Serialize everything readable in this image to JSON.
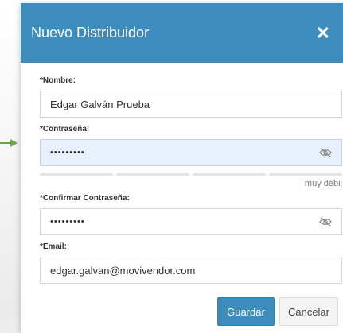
{
  "modal": {
    "title": "Nuevo Distribuidor",
    "close_icon": "close-icon"
  },
  "form": {
    "nombre": {
      "label": "*Nombre:",
      "value": "Edgar Galván Prueba"
    },
    "contrasena": {
      "label": "*Contraseña:",
      "value": "•••••••••",
      "icon": "eye-slash-icon"
    },
    "strength": {
      "text": "muy débil",
      "segments": 4,
      "filled": 0
    },
    "confirmar": {
      "label": "*Confirmar Contraseña:",
      "value": "•••••••••",
      "icon": "eye-slash-icon"
    },
    "email": {
      "label": "*Email:",
      "value": "edgar.galvan@movivendor.com"
    }
  },
  "buttons": {
    "guardar": "Guardar",
    "cancelar": "Cancelar"
  },
  "colors": {
    "header": "#3c8dbc",
    "primary_button": "#3c8dbc",
    "autofill_background": "#e8f0fe",
    "pointer_arrow": "#6aa84f"
  }
}
